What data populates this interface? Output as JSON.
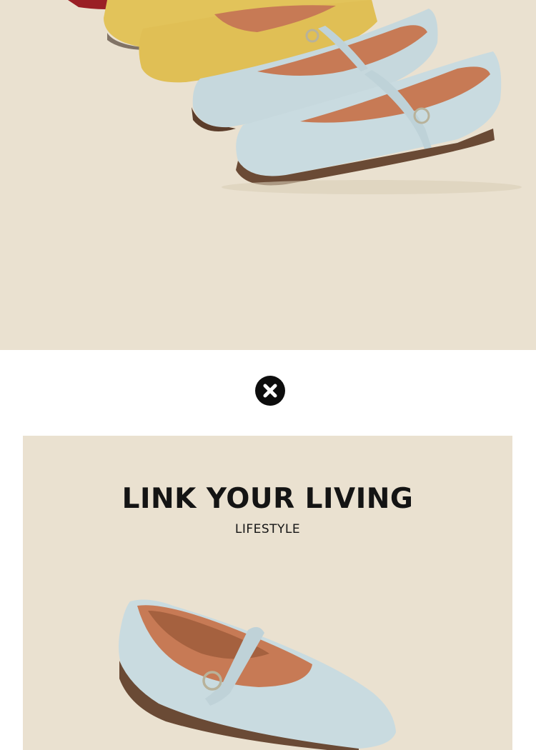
{
  "banner": {
    "title": "LINK YOUR LIVING",
    "subtitle": "LIFESTYLE"
  },
  "colors": {
    "background_beige": "#eae1d0",
    "shoe_blue": "#c9dbe0",
    "shoe_yellow": "#e2c35a",
    "shoe_red": "#9a1f25",
    "lining_brown": "#c77a55",
    "close_button": "#0d0d0d"
  },
  "icons": {
    "close": "close-icon"
  }
}
